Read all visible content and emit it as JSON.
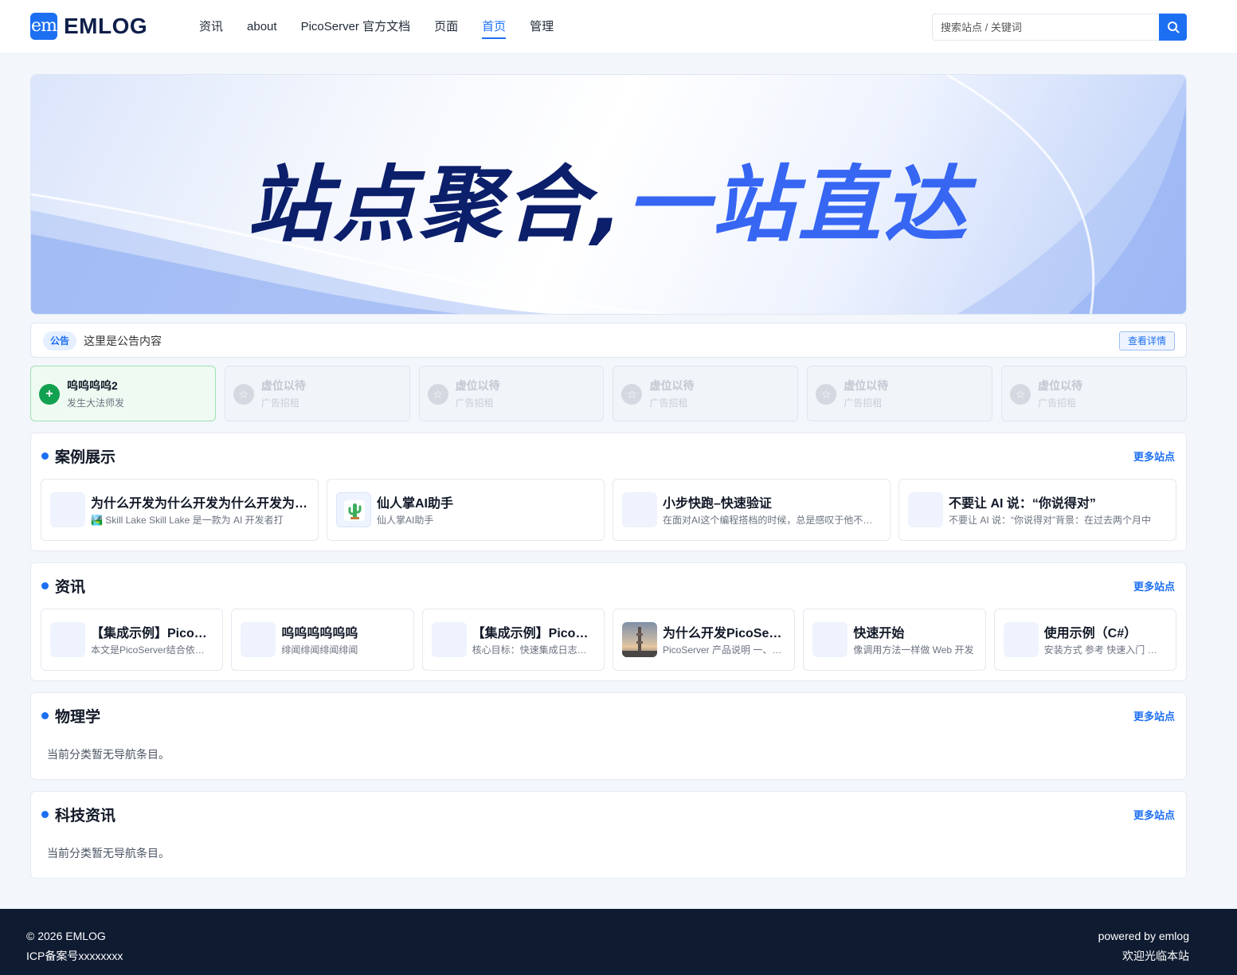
{
  "header": {
    "logo_mark": "em",
    "logo_text": "EMLOG",
    "nav": [
      "资讯",
      "about",
      "PicoServer 官方文档",
      "页面",
      "首页",
      "管理"
    ],
    "nav_active": "首页",
    "search_placeholder": "搜索站点 / 关键词"
  },
  "banner": {
    "title_part1": "站点聚合,",
    "title_part2": "一站直达"
  },
  "notice": {
    "tag": "公告",
    "text": "这里是公告内容",
    "button": "查看详情"
  },
  "ads": [
    {
      "title": "呜呜呜呜2",
      "subtitle": "发生大法师发",
      "icon": "plus-icon",
      "active": true
    },
    {
      "title": "虚位以待",
      "subtitle": "广告招租",
      "icon": "star-icon",
      "active": false
    },
    {
      "title": "虚位以待",
      "subtitle": "广告招租",
      "icon": "star-icon",
      "active": false
    },
    {
      "title": "虚位以待",
      "subtitle": "广告招租",
      "icon": "star-icon",
      "active": false
    },
    {
      "title": "虚位以待",
      "subtitle": "广告招租",
      "icon": "star-icon",
      "active": false
    },
    {
      "title": "虚位以待",
      "subtitle": "广告招租",
      "icon": "star-icon",
      "active": false
    }
  ],
  "sections": [
    {
      "title": "案例展示",
      "more": "更多站点",
      "cards": [
        {
          "title": "为什么开发为什么开发为什么开发为什么开发",
          "desc": "🏞️ Skill Lake Skill Lake 是一款为 AI 开发者打",
          "thumb": "placeholder"
        },
        {
          "title": "仙人掌AI助手",
          "desc": "仙人掌AI助手",
          "thumb": "cactus-icon"
        },
        {
          "title": "小步快跑–快速验证",
          "desc": "在面对AI这个编程搭档的时候，总是感叹于他不知疲倦",
          "thumb": "placeholder"
        },
        {
          "title": "不要让 AI 说：“你说得对”",
          "desc": "不要让 AI 说：“你说得对”背景：在过去两个月中",
          "thumb": "placeholder"
        }
      ]
    },
    {
      "title": "资讯",
      "more": "更多站点",
      "cards": [
        {
          "title": "【集成示例】PicoServer",
          "desc": "本文是PicoServer结合依赖注入",
          "thumb": "placeholder"
        },
        {
          "title": "呜呜呜呜呜呜",
          "desc": "绯闻绯闻绯闻绯闻",
          "thumb": "placeholder"
        },
        {
          "title": "【集成示例】PicoServer",
          "desc": "核心目标：快速集成日志组件",
          "thumb": "placeholder"
        },
        {
          "title": "为什么开发PicoServer",
          "desc": "PicoServer 产品说明 一、背景",
          "thumb": "tower-photo"
        },
        {
          "title": "快速开始",
          "desc": "像调用方法一样做 Web 开发",
          "thumb": "placeholder"
        },
        {
          "title": "使用示例（C#）",
          "desc": "安装方式 参考 快速入门 教程",
          "thumb": "placeholder"
        }
      ]
    },
    {
      "title": "物理学",
      "more": "更多站点",
      "empty": "当前分类暂无导航条目。"
    },
    {
      "title": "科技资讯",
      "more": "更多站点",
      "empty": "当前分类暂无导航条目。"
    }
  ],
  "footer": {
    "copyright": "© 2026 EMLOG",
    "icp": "ICP备案号xxxxxxxx",
    "powered": "powered by emlog",
    "welcome": "欢迎光临本站"
  },
  "colors": {
    "accent": "#1d6ff2",
    "footer_bg": "#0f1b31",
    "banner_dark": "#0c1f6b",
    "banner_blue": "#3766f3",
    "ad_active_bg": "#effbf2",
    "ad_active_icon": "#12a150"
  }
}
